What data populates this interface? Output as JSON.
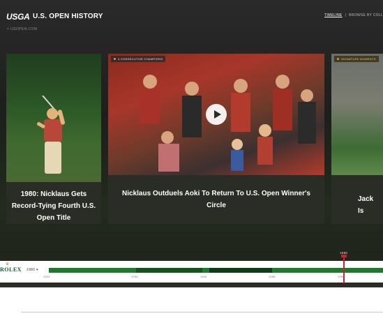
{
  "header": {
    "logo": "USGA",
    "title": "U.S. OPEN HISTORY",
    "site_link": "< USOPEN.COM",
    "nav": [
      "TIMELINE",
      "|",
      "BROWSE BY COLL"
    ]
  },
  "cards": [
    {
      "caption": "1980: Nicklaus Gets Record-Tying Fourth U.S. Open Title",
      "tag": ""
    },
    {
      "caption": "Nicklaus Outduels Aoki To Return To U.S. Open Winner's Circle",
      "tag": "4 CONSECUTIVE CHAMPIONS"
    },
    {
      "caption": "Jack Is",
      "tag": "SIGNATURE MOMENTS"
    }
  ],
  "timeline": {
    "sponsor": "ROLEX",
    "year_select": "1980 ▾",
    "current_year": "1980",
    "tick_labels": [
      "1920",
      "1936",
      "1944",
      "1956",
      "1980"
    ],
    "colors": {
      "track": "#1f7a2f",
      "cursor": "#d11f2b"
    }
  },
  "icons": [
    "play-icon",
    "crown-icon",
    "tag-icon"
  ]
}
